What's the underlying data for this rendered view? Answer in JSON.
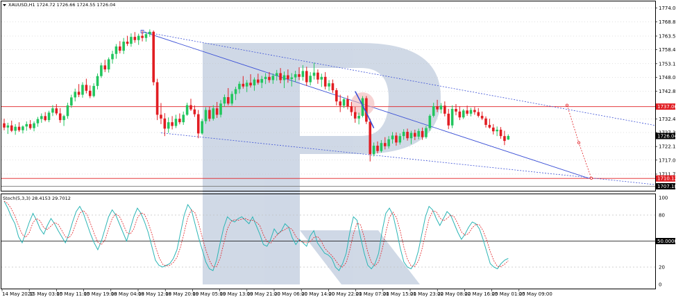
{
  "header": {
    "symbol_info": "XAUUSD,H1  1724.72 1726.66 1724.55 1726.04",
    "stoch_info": "Stoch(5,3,3) 28.4153 29.7012"
  },
  "colors": {
    "bull": "#22c55e",
    "bear": "#e11d22",
    "price_line": "#e11d22",
    "channel_line": "#3a4fd6",
    "stoch_main": "#2bb5b5",
    "stoch_signal": "#e11d22",
    "watermark": "#a9bad2",
    "grid": "#c0c0c0"
  },
  "price_axis": {
    "ticks": [
      "1774.00",
      "1768.85",
      "1763.50",
      "1758.45",
      "1753.15",
      "1748.00",
      "1742.80",
      "1732.40",
      "1727.35",
      "1722.10",
      "1717.00",
      "1711.75"
    ],
    "current_price": "1726.04",
    "level_1737": "1737.06",
    "level_1710": "1710.12",
    "level_1707": "1707.18"
  },
  "stoch_axis": {
    "ticks": [
      "100",
      "80",
      "20",
      "0"
    ],
    "mid_level": "50.0000"
  },
  "time_axis": {
    "labels": [
      "14 May 2020",
      "15 May 03:00",
      "15 May 11:00",
      "15 May 19:00",
      "18 May 04:00",
      "18 May 12:00",
      "18 May 20:00",
      "19 May 05:00",
      "19 May 13:00",
      "19 May 21:00",
      "20 May 06:00",
      "20 May 14:00",
      "20 May 22:00",
      "21 May 07:00",
      "21 May 15:00",
      "21 May 23:00",
      "22 May 08:00",
      "22 May 16:00",
      "25 May 01:00",
      "25 May 09:00"
    ]
  },
  "chart_data": {
    "type": "candlestick",
    "symbol": "XAUUSD",
    "timeframe": "H1",
    "ylim": [
      1705.5,
      1776.5
    ],
    "candles": [
      {
        "o": 1730.8,
        "h": 1732.5,
        "l": 1728.2,
        "c": 1729.2
      },
      {
        "o": 1729.2,
        "h": 1731.0,
        "l": 1726.8,
        "c": 1730.0
      },
      {
        "o": 1730.0,
        "h": 1731.8,
        "l": 1727.5,
        "c": 1728.0
      },
      {
        "o": 1728.0,
        "h": 1730.5,
        "l": 1726.5,
        "c": 1729.5
      },
      {
        "o": 1729.5,
        "h": 1731.2,
        "l": 1727.6,
        "c": 1728.2
      },
      {
        "o": 1728.2,
        "h": 1730.0,
        "l": 1727.0,
        "c": 1729.6
      },
      {
        "o": 1729.6,
        "h": 1731.5,
        "l": 1728.0,
        "c": 1730.5
      },
      {
        "o": 1730.5,
        "h": 1732.0,
        "l": 1728.4,
        "c": 1729.0
      },
      {
        "o": 1729.0,
        "h": 1731.5,
        "l": 1727.8,
        "c": 1730.8
      },
      {
        "o": 1730.8,
        "h": 1733.2,
        "l": 1729.5,
        "c": 1732.4
      },
      {
        "o": 1732.4,
        "h": 1734.5,
        "l": 1731.0,
        "c": 1733.5
      },
      {
        "o": 1733.5,
        "h": 1735.0,
        "l": 1731.5,
        "c": 1732.0
      },
      {
        "o": 1732.0,
        "h": 1735.5,
        "l": 1731.2,
        "c": 1734.8
      },
      {
        "o": 1734.8,
        "h": 1737.6,
        "l": 1733.5,
        "c": 1736.4
      },
      {
        "o": 1736.4,
        "h": 1738.0,
        "l": 1733.8,
        "c": 1734.5
      },
      {
        "o": 1734.5,
        "h": 1736.5,
        "l": 1731.0,
        "c": 1732.0
      },
      {
        "o": 1732.0,
        "h": 1734.0,
        "l": 1729.8,
        "c": 1733.5
      },
      {
        "o": 1733.5,
        "h": 1738.5,
        "l": 1732.5,
        "c": 1737.5
      },
      {
        "o": 1737.5,
        "h": 1741.5,
        "l": 1736.6,
        "c": 1740.5
      },
      {
        "o": 1740.5,
        "h": 1743.8,
        "l": 1739.0,
        "c": 1742.6
      },
      {
        "o": 1742.6,
        "h": 1745.5,
        "l": 1740.6,
        "c": 1741.5
      },
      {
        "o": 1741.5,
        "h": 1746.2,
        "l": 1740.4,
        "c": 1745.2
      },
      {
        "o": 1745.2,
        "h": 1747.5,
        "l": 1742.0,
        "c": 1743.0
      },
      {
        "o": 1743.0,
        "h": 1745.0,
        "l": 1740.2,
        "c": 1741.0
      },
      {
        "o": 1741.0,
        "h": 1745.8,
        "l": 1740.5,
        "c": 1744.8
      },
      {
        "o": 1744.8,
        "h": 1749.5,
        "l": 1743.5,
        "c": 1748.5
      },
      {
        "o": 1748.5,
        "h": 1753.5,
        "l": 1747.8,
        "c": 1752.5
      },
      {
        "o": 1752.5,
        "h": 1754.6,
        "l": 1750.0,
        "c": 1751.0
      },
      {
        "o": 1751.0,
        "h": 1755.5,
        "l": 1749.8,
        "c": 1754.8
      },
      {
        "o": 1754.8,
        "h": 1758.0,
        "l": 1753.2,
        "c": 1756.8
      },
      {
        "o": 1756.8,
        "h": 1760.5,
        "l": 1755.0,
        "c": 1759.6
      },
      {
        "o": 1759.6,
        "h": 1761.6,
        "l": 1757.0,
        "c": 1758.0
      },
      {
        "o": 1758.0,
        "h": 1762.8,
        "l": 1756.8,
        "c": 1761.4
      },
      {
        "o": 1761.4,
        "h": 1763.6,
        "l": 1759.8,
        "c": 1760.6
      },
      {
        "o": 1760.6,
        "h": 1764.5,
        "l": 1759.5,
        "c": 1763.2
      },
      {
        "o": 1763.2,
        "h": 1765.0,
        "l": 1761.0,
        "c": 1762.0
      },
      {
        "o": 1762.0,
        "h": 1764.4,
        "l": 1760.2,
        "c": 1763.6
      },
      {
        "o": 1763.6,
        "h": 1765.5,
        "l": 1761.5,
        "c": 1762.8
      },
      {
        "o": 1762.8,
        "h": 1765.0,
        "l": 1761.4,
        "c": 1764.2
      },
      {
        "o": 1764.2,
        "h": 1766.0,
        "l": 1763.2,
        "c": 1765.1
      },
      {
        "o": 1765.1,
        "h": 1765.6,
        "l": 1745.0,
        "c": 1746.2
      },
      {
        "o": 1746.2,
        "h": 1747.5,
        "l": 1732.0,
        "c": 1734.0
      },
      {
        "o": 1734.0,
        "h": 1738.4,
        "l": 1730.5,
        "c": 1732.6
      },
      {
        "o": 1732.6,
        "h": 1734.6,
        "l": 1726.0,
        "c": 1728.8
      },
      {
        "o": 1728.8,
        "h": 1733.0,
        "l": 1727.2,
        "c": 1731.2
      },
      {
        "o": 1731.2,
        "h": 1733.5,
        "l": 1728.5,
        "c": 1729.8
      },
      {
        "o": 1729.8,
        "h": 1734.0,
        "l": 1729.0,
        "c": 1732.5
      },
      {
        "o": 1732.5,
        "h": 1734.5,
        "l": 1730.4,
        "c": 1731.2
      },
      {
        "o": 1731.2,
        "h": 1735.2,
        "l": 1730.2,
        "c": 1734.0
      },
      {
        "o": 1734.0,
        "h": 1738.5,
        "l": 1733.6,
        "c": 1737.6
      },
      {
        "o": 1737.6,
        "h": 1740.0,
        "l": 1735.4,
        "c": 1736.0
      },
      {
        "o": 1736.0,
        "h": 1737.5,
        "l": 1733.2,
        "c": 1734.2
      },
      {
        "o": 1734.2,
        "h": 1735.8,
        "l": 1725.2,
        "c": 1727.0
      },
      {
        "o": 1727.0,
        "h": 1732.5,
        "l": 1726.5,
        "c": 1731.6
      },
      {
        "o": 1731.6,
        "h": 1736.8,
        "l": 1730.6,
        "c": 1735.8
      },
      {
        "o": 1735.8,
        "h": 1737.0,
        "l": 1731.5,
        "c": 1732.5
      },
      {
        "o": 1732.5,
        "h": 1737.6,
        "l": 1731.8,
        "c": 1736.4
      },
      {
        "o": 1736.4,
        "h": 1738.8,
        "l": 1732.8,
        "c": 1734.0
      },
      {
        "o": 1734.0,
        "h": 1739.5,
        "l": 1733.0,
        "c": 1738.2
      },
      {
        "o": 1738.2,
        "h": 1741.6,
        "l": 1737.0,
        "c": 1740.6
      },
      {
        "o": 1740.6,
        "h": 1744.0,
        "l": 1737.5,
        "c": 1738.2
      },
      {
        "o": 1738.2,
        "h": 1742.8,
        "l": 1737.4,
        "c": 1741.8
      },
      {
        "o": 1741.8,
        "h": 1744.5,
        "l": 1739.5,
        "c": 1743.6
      },
      {
        "o": 1743.6,
        "h": 1746.5,
        "l": 1742.0,
        "c": 1745.6
      },
      {
        "o": 1745.6,
        "h": 1748.5,
        "l": 1743.8,
        "c": 1744.6
      },
      {
        "o": 1744.6,
        "h": 1747.0,
        "l": 1742.5,
        "c": 1746.0
      },
      {
        "o": 1746.0,
        "h": 1749.2,
        "l": 1744.2,
        "c": 1745.0
      },
      {
        "o": 1745.0,
        "h": 1748.0,
        "l": 1743.0,
        "c": 1747.2
      },
      {
        "o": 1747.2,
        "h": 1749.4,
        "l": 1745.3,
        "c": 1746.0
      },
      {
        "o": 1746.0,
        "h": 1748.6,
        "l": 1744.0,
        "c": 1747.4
      },
      {
        "o": 1747.4,
        "h": 1749.6,
        "l": 1745.5,
        "c": 1748.2
      },
      {
        "o": 1748.2,
        "h": 1750.0,
        "l": 1746.0,
        "c": 1747.0
      },
      {
        "o": 1747.0,
        "h": 1749.5,
        "l": 1745.6,
        "c": 1748.6
      },
      {
        "o": 1748.6,
        "h": 1750.8,
        "l": 1746.8,
        "c": 1749.6
      },
      {
        "o": 1749.6,
        "h": 1751.5,
        "l": 1745.8,
        "c": 1747.0
      },
      {
        "o": 1747.0,
        "h": 1750.2,
        "l": 1744.0,
        "c": 1748.8
      },
      {
        "o": 1748.8,
        "h": 1751.0,
        "l": 1746.0,
        "c": 1747.4
      },
      {
        "o": 1747.4,
        "h": 1749.6,
        "l": 1744.6,
        "c": 1748.0
      },
      {
        "o": 1748.0,
        "h": 1750.5,
        "l": 1746.2,
        "c": 1749.2
      },
      {
        "o": 1749.2,
        "h": 1751.8,
        "l": 1747.0,
        "c": 1748.2
      },
      {
        "o": 1748.2,
        "h": 1752.6,
        "l": 1746.8,
        "c": 1750.4
      },
      {
        "o": 1750.4,
        "h": 1752.0,
        "l": 1744.8,
        "c": 1746.2
      },
      {
        "o": 1746.2,
        "h": 1750.0,
        "l": 1745.0,
        "c": 1748.6
      },
      {
        "o": 1748.6,
        "h": 1753.5,
        "l": 1747.2,
        "c": 1749.8
      },
      {
        "o": 1749.8,
        "h": 1751.0,
        "l": 1745.6,
        "c": 1747.2
      },
      {
        "o": 1747.2,
        "h": 1749.4,
        "l": 1744.4,
        "c": 1748.2
      },
      {
        "o": 1748.2,
        "h": 1750.0,
        "l": 1743.5,
        "c": 1744.6
      },
      {
        "o": 1744.6,
        "h": 1747.0,
        "l": 1743.0,
        "c": 1745.8
      },
      {
        "o": 1745.8,
        "h": 1747.2,
        "l": 1742.2,
        "c": 1743.2
      },
      {
        "o": 1743.2,
        "h": 1744.0,
        "l": 1737.5,
        "c": 1739.0
      },
      {
        "o": 1739.0,
        "h": 1741.5,
        "l": 1735.0,
        "c": 1737.4
      },
      {
        "o": 1737.4,
        "h": 1740.4,
        "l": 1736.5,
        "c": 1739.8
      },
      {
        "o": 1739.8,
        "h": 1741.2,
        "l": 1736.0,
        "c": 1737.2
      },
      {
        "o": 1737.2,
        "h": 1738.8,
        "l": 1733.6,
        "c": 1735.0
      },
      {
        "o": 1735.0,
        "h": 1737.0,
        "l": 1731.0,
        "c": 1732.6
      },
      {
        "o": 1732.6,
        "h": 1734.8,
        "l": 1730.4,
        "c": 1733.6
      },
      {
        "o": 1733.6,
        "h": 1741.0,
        "l": 1733.0,
        "c": 1740.2
      },
      {
        "o": 1740.2,
        "h": 1741.0,
        "l": 1730.5,
        "c": 1731.4
      },
      {
        "o": 1731.4,
        "h": 1732.5,
        "l": 1716.5,
        "c": 1719.2
      },
      {
        "o": 1719.2,
        "h": 1723.6,
        "l": 1718.4,
        "c": 1722.4
      },
      {
        "o": 1722.4,
        "h": 1724.0,
        "l": 1719.5,
        "c": 1720.4
      },
      {
        "o": 1720.4,
        "h": 1724.5,
        "l": 1719.8,
        "c": 1723.4
      },
      {
        "o": 1723.4,
        "h": 1725.6,
        "l": 1721.0,
        "c": 1722.2
      },
      {
        "o": 1722.2,
        "h": 1726.0,
        "l": 1721.3,
        "c": 1724.8
      },
      {
        "o": 1724.8,
        "h": 1727.5,
        "l": 1723.2,
        "c": 1726.2
      },
      {
        "o": 1726.2,
        "h": 1727.4,
        "l": 1722.4,
        "c": 1723.6
      },
      {
        "o": 1723.6,
        "h": 1727.0,
        "l": 1722.8,
        "c": 1726.0
      },
      {
        "o": 1726.0,
        "h": 1728.6,
        "l": 1724.6,
        "c": 1727.6
      },
      {
        "o": 1727.6,
        "h": 1728.8,
        "l": 1724.3,
        "c": 1725.2
      },
      {
        "o": 1725.2,
        "h": 1728.0,
        "l": 1723.0,
        "c": 1727.2
      },
      {
        "o": 1727.2,
        "h": 1728.4,
        "l": 1724.5,
        "c": 1725.8
      },
      {
        "o": 1725.8,
        "h": 1728.8,
        "l": 1724.8,
        "c": 1727.9
      },
      {
        "o": 1727.9,
        "h": 1729.2,
        "l": 1724.6,
        "c": 1725.6
      },
      {
        "o": 1725.6,
        "h": 1729.8,
        "l": 1725.0,
        "c": 1729.0
      },
      {
        "o": 1729.0,
        "h": 1734.2,
        "l": 1728.0,
        "c": 1733.6
      },
      {
        "o": 1733.6,
        "h": 1738.5,
        "l": 1733.0,
        "c": 1737.2
      },
      {
        "o": 1737.2,
        "h": 1739.6,
        "l": 1735.0,
        "c": 1736.0
      },
      {
        "o": 1736.0,
        "h": 1738.4,
        "l": 1734.5,
        "c": 1737.4
      },
      {
        "o": 1737.4,
        "h": 1739.0,
        "l": 1733.4,
        "c": 1734.4
      },
      {
        "o": 1734.4,
        "h": 1736.2,
        "l": 1728.6,
        "c": 1730.0
      },
      {
        "o": 1730.0,
        "h": 1737.5,
        "l": 1729.0,
        "c": 1736.2
      },
      {
        "o": 1736.2,
        "h": 1738.0,
        "l": 1733.8,
        "c": 1735.2
      },
      {
        "o": 1735.2,
        "h": 1737.2,
        "l": 1732.0,
        "c": 1733.0
      },
      {
        "o": 1733.0,
        "h": 1736.2,
        "l": 1732.4,
        "c": 1735.6
      },
      {
        "o": 1735.6,
        "h": 1737.4,
        "l": 1733.6,
        "c": 1734.4
      },
      {
        "o": 1734.4,
        "h": 1736.6,
        "l": 1733.4,
        "c": 1735.8
      },
      {
        "o": 1735.8,
        "h": 1736.9,
        "l": 1734.0,
        "c": 1735.0
      },
      {
        "o": 1735.0,
        "h": 1736.5,
        "l": 1733.0,
        "c": 1733.6
      },
      {
        "o": 1733.6,
        "h": 1735.2,
        "l": 1732.0,
        "c": 1732.6
      },
      {
        "o": 1732.6,
        "h": 1733.4,
        "l": 1729.2,
        "c": 1730.2
      },
      {
        "o": 1730.2,
        "h": 1732.5,
        "l": 1728.8,
        "c": 1729.2
      },
      {
        "o": 1729.2,
        "h": 1730.5,
        "l": 1726.6,
        "c": 1727.8
      },
      {
        "o": 1727.8,
        "h": 1729.6,
        "l": 1726.0,
        "c": 1728.4
      },
      {
        "o": 1728.4,
        "h": 1729.4,
        "l": 1725.0,
        "c": 1726.0
      },
      {
        "o": 1726.0,
        "h": 1728.0,
        "l": 1722.6,
        "c": 1724.2
      },
      {
        "o": 1724.72,
        "h": 1726.66,
        "l": 1724.55,
        "c": 1726.04
      }
    ],
    "stoch_main": [
      96,
      88,
      78,
      70,
      55,
      48,
      60,
      72,
      82,
      74,
      64,
      58,
      68,
      76,
      70,
      62,
      55,
      48,
      58,
      72,
      84,
      90,
      82,
      70,
      58,
      48,
      40,
      50,
      64,
      78,
      86,
      80,
      70,
      60,
      50,
      64,
      78,
      88,
      82,
      72,
      60,
      44,
      28,
      22,
      20,
      22,
      24,
      30,
      40,
      60,
      80,
      92,
      86,
      70,
      54,
      40,
      26,
      18,
      16,
      28,
      48,
      66,
      78,
      74,
      72,
      76,
      78,
      74,
      70,
      78,
      68,
      58,
      46,
      44,
      52,
      64,
      58,
      62,
      70,
      66,
      54,
      46,
      52,
      48,
      44,
      56,
      62,
      48,
      42,
      36,
      34,
      30,
      20,
      16,
      24,
      36,
      60,
      78,
      74,
      54,
      36,
      22,
      18,
      24,
      36,
      62,
      82,
      88,
      80,
      62,
      42,
      26,
      20,
      18,
      24,
      38,
      58,
      78,
      90,
      86,
      76,
      68,
      76,
      84,
      80,
      70,
      60,
      52,
      58,
      66,
      72,
      70,
      64,
      52,
      38,
      24,
      20,
      18,
      24,
      28,
      30
    ]
  }
}
